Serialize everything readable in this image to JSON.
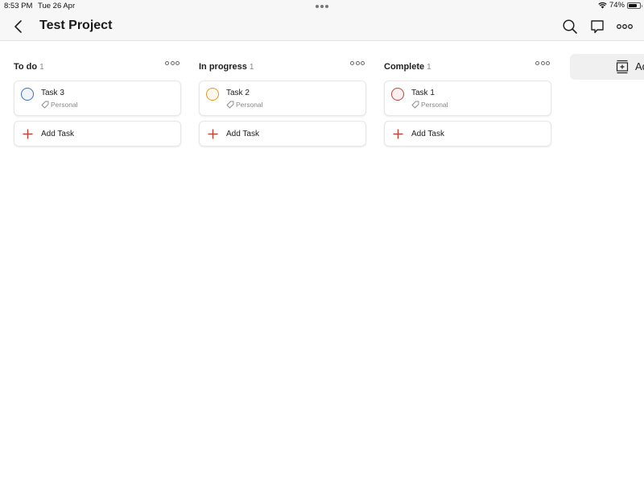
{
  "status_bar": {
    "time": "8:53 PM",
    "date": "Tue 26 Apr",
    "battery": "74%",
    "battery_level": 0.74
  },
  "header": {
    "title": "Test Project",
    "icons": [
      "back-chevron-icon",
      "search-icon",
      "comment-icon",
      "more-icon"
    ]
  },
  "columns": [
    {
      "title": "To do",
      "count": "1",
      "tasks": [
        {
          "name": "Task 3",
          "label": "Personal",
          "circle_color": "#3b6fc9"
        }
      ],
      "add_label": "Add Task"
    },
    {
      "title": "In progress",
      "count": "1",
      "tasks": [
        {
          "name": "Task 2",
          "label": "Personal",
          "circle_color": "#e19a1e"
        }
      ],
      "add_label": "Add Task"
    },
    {
      "title": "Complete",
      "count": "1",
      "tasks": [
        {
          "name": "Task 1",
          "label": "Personal",
          "circle_color": "#c0463a"
        }
      ],
      "add_label": "Add Task"
    }
  ],
  "add_section": {
    "label": "Add section"
  },
  "colors": {
    "accent": "#c0463a"
  }
}
